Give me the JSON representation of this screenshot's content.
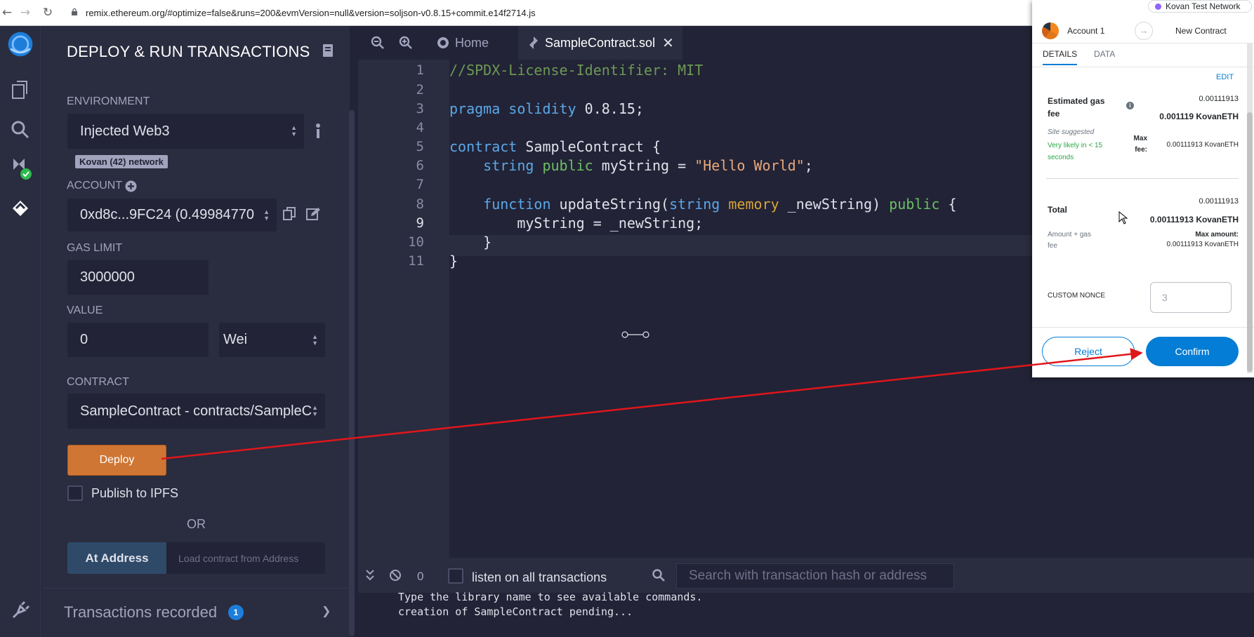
{
  "browser": {
    "url": "remix.ethereum.org/#optimize=false&runs=200&evmVersion=null&version=soljson-v0.8.15+commit.e14f2714.js"
  },
  "panel": {
    "title": "DEPLOY & RUN TRANSACTIONS",
    "environment_label": "ENVIRONMENT",
    "environment_value": "Injected Web3",
    "network_badge": "Kovan (42) network",
    "account_label": "ACCOUNT",
    "account_value": "0xd8c...9FC24 (0.49984770",
    "gas_limit_label": "GAS LIMIT",
    "gas_limit_value": "3000000",
    "value_label": "VALUE",
    "value_amount": "0",
    "value_unit": "Wei",
    "contract_label": "CONTRACT",
    "contract_value": "SampleContract - contracts/SampleC",
    "deploy_label": "Deploy",
    "ipfs_label": "Publish to IPFS",
    "or_label": "OR",
    "at_address_label": "At Address",
    "at_address_placeholder": "Load contract from Address",
    "transactions_label": "Transactions recorded",
    "transactions_count": "1"
  },
  "editor": {
    "tab_home": "Home",
    "tab_file": "SampleContract.sol",
    "line_numbers": [
      "1",
      "2",
      "3",
      "4",
      "5",
      "6",
      "7",
      "8",
      "9",
      "10",
      "11"
    ],
    "lines": {
      "l1_comment": "//SPDX-License-Identifier: MIT",
      "l3_kw": "pragma solidity",
      "l3_rest": " 0.8.15;",
      "l5_kw": "contract",
      "l5_rest": " SampleContract {",
      "l6_type": "string",
      "l6_mod": "public",
      "l6_rest": " myString = ",
      "l6_str": "\"Hello World\"",
      "l6_end": ";",
      "l8_kw": "function",
      "l8_name": " updateString(",
      "l8_type": "string",
      "l8_mem": "memory",
      "l8_param": " _newString) ",
      "l8_mod": "public",
      "l8_end": " {",
      "l9": "myString = _newString;",
      "l10": "}",
      "l11": "}"
    }
  },
  "terminal": {
    "pending_count": "0",
    "listen_label": "listen on all transactions",
    "search_placeholder": "Search with transaction hash or address",
    "line1": "Type the library name to see available commands.",
    "line2": "creation of SampleContract pending..."
  },
  "metamask": {
    "network": "Kovan Test Network",
    "account": "Account 1",
    "new_contract": "New Contract",
    "tab_details": "DETAILS",
    "tab_data": "DATA",
    "edit": "EDIT",
    "est_gas_label_1": "Estimated gas",
    "est_gas_label_2": "fee",
    "est_gas_value": "0.00111913",
    "est_gas_eth": "0.001119 KovanETH",
    "site_suggested": "Site suggested",
    "likely_1": "Very likely in < 15",
    "likely_2": "seconds",
    "max_fee_label_1": "Max",
    "max_fee_label_2": "fee:",
    "max_fee_value": "0.00111913 KovanETH",
    "total_label": "Total",
    "total_value": "0.00111913",
    "total_eth": "0.00111913 KovanETH",
    "amount_gas_1": "Amount + gas",
    "amount_gas_2": "fee",
    "max_amount_label": "Max amount:",
    "max_amount_value": "0.00111913 KovanETH",
    "custom_nonce_label": "CUSTOM NONCE",
    "custom_nonce_placeholder": "3",
    "reject": "Reject",
    "confirm": "Confirm"
  },
  "colors": {
    "deploy": "#cf7634",
    "confirm": "#037dd6",
    "annotation_arrow": "#e0161b"
  }
}
